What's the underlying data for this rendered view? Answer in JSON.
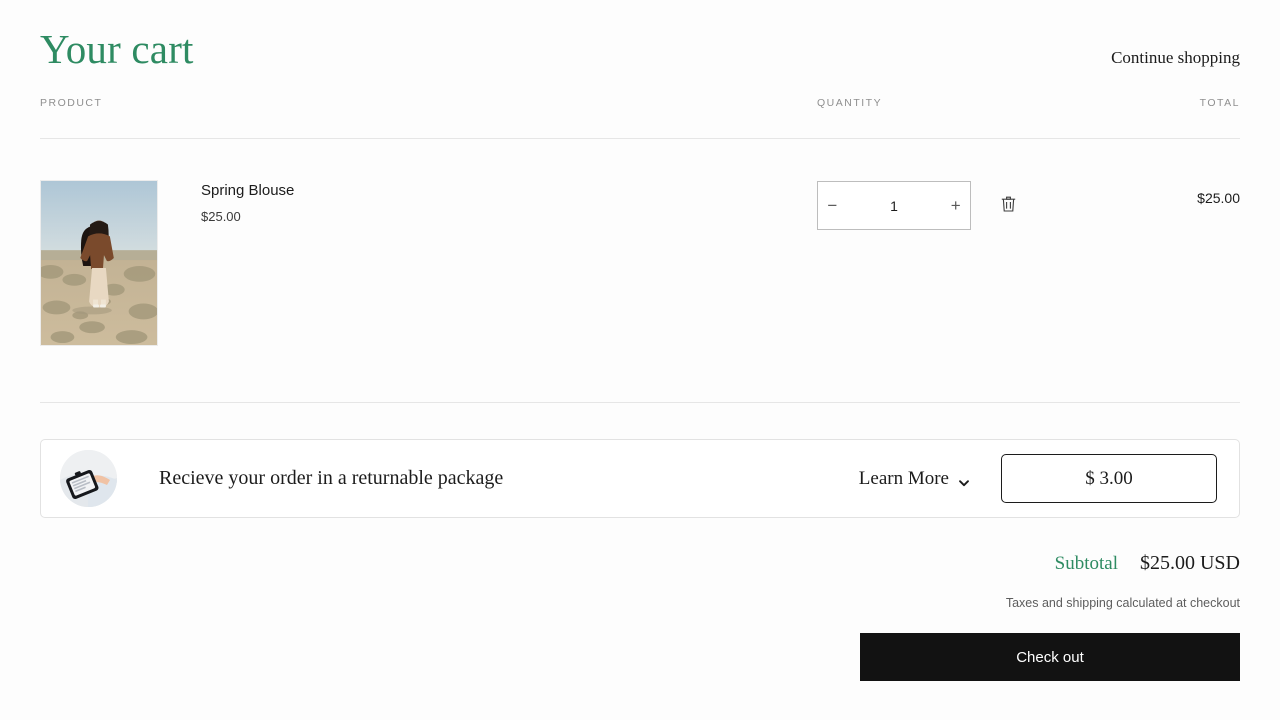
{
  "header": {
    "title": "Your cart",
    "continue_shopping": "Continue shopping"
  },
  "table": {
    "columns": {
      "product": "PRODUCT",
      "quantity": "QUANTITY",
      "total": "TOTAL"
    }
  },
  "items": [
    {
      "name": "Spring Blouse",
      "price": "$25.00",
      "quantity": "1",
      "line_total": "$25.00",
      "decrease_label": "−",
      "increase_label": "+",
      "remove_icon": "trash-icon",
      "image_alt": "Model in brown blouse and cream wide-leg pants standing in a desert landscape"
    }
  ],
  "returnable": {
    "text": "Recieve your order in a returnable package",
    "learn_more": "Learn More",
    "chevron_icon": "chevron-down-icon",
    "price": "$ 3.00",
    "image_alt": "Hand holding a dark returnable package"
  },
  "totals": {
    "subtotal_label": "Subtotal",
    "subtotal_value": "$25.00 USD",
    "tax_note": "Taxes and shipping calculated at checkout",
    "checkout_label": "Check out"
  },
  "colors": {
    "accent_green": "#2e8b62",
    "checkout_bg": "#121212",
    "rule": "#e6e6e6",
    "muted_text": "#8f8f8f"
  }
}
